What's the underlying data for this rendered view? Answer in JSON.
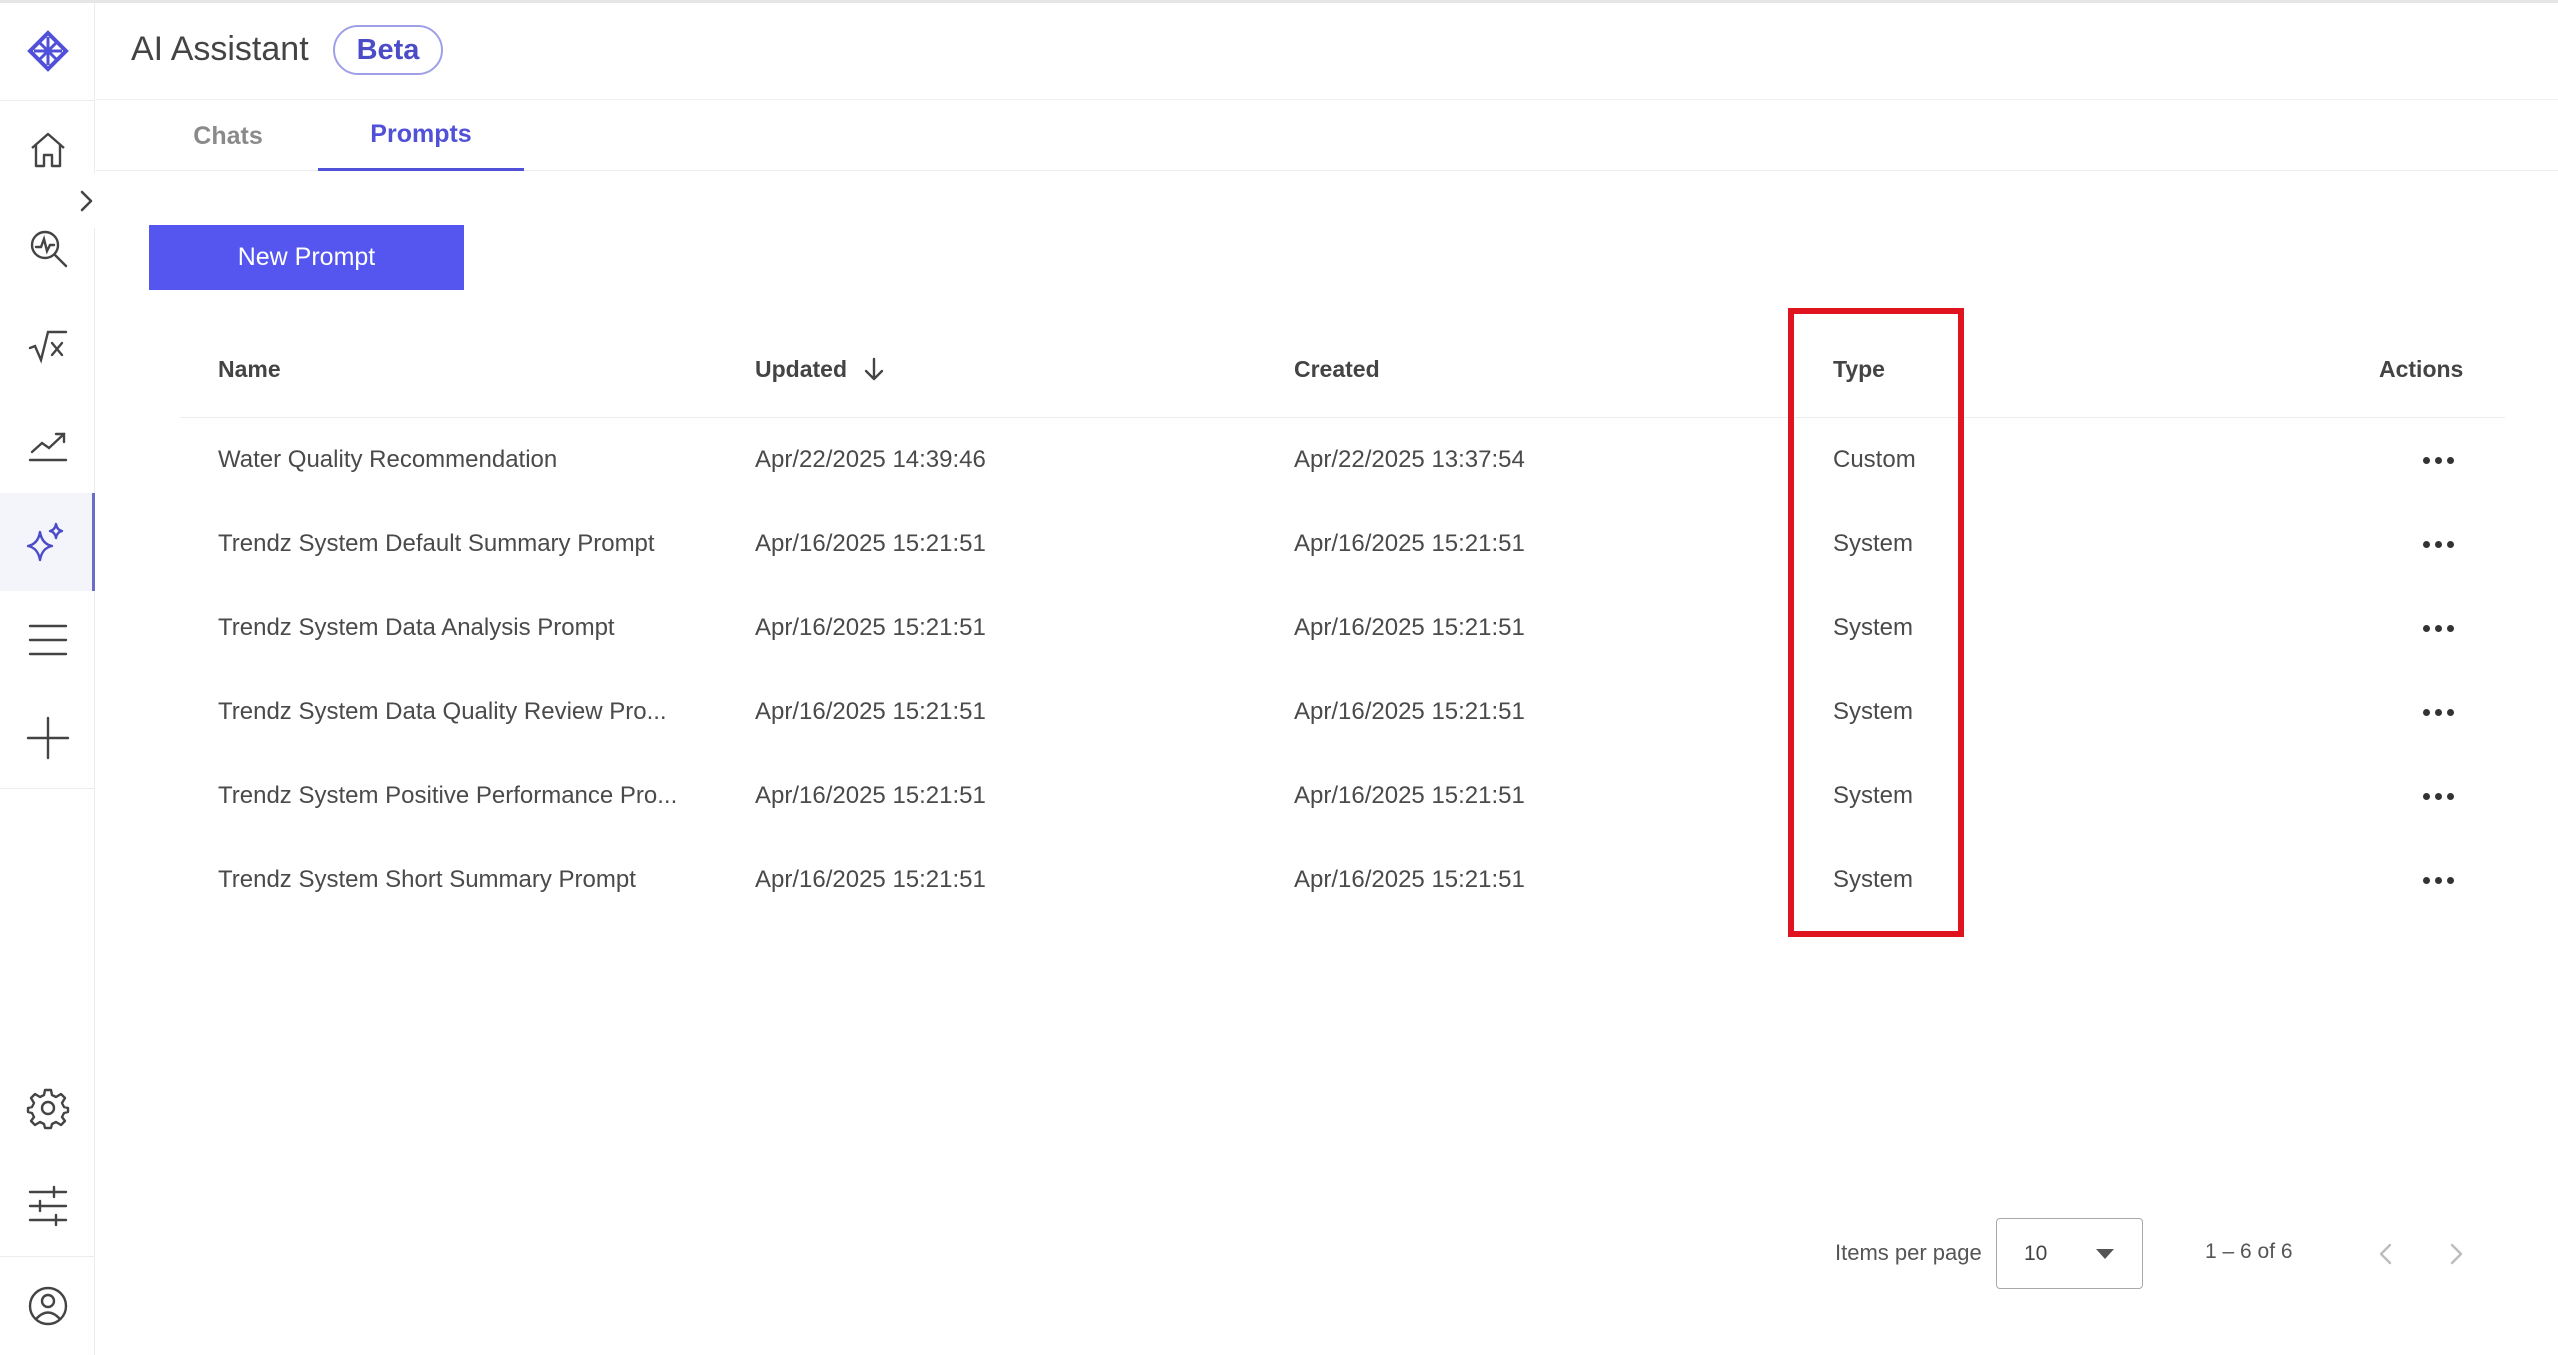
{
  "header": {
    "title": "AI Assistant",
    "badge": "Beta"
  },
  "tabs": [
    {
      "label": "Chats",
      "active": false
    },
    {
      "label": "Prompts",
      "active": true
    }
  ],
  "toolbar": {
    "new_prompt_label": "New Prompt"
  },
  "table": {
    "columns": {
      "name": "Name",
      "updated": "Updated",
      "created": "Created",
      "type": "Type",
      "actions": "Actions"
    },
    "sort": {
      "column": "updated",
      "direction": "desc"
    },
    "rows": [
      {
        "name": "Water Quality Recommendation",
        "updated": "Apr/22/2025 14:39:46",
        "created": "Apr/22/2025 13:37:54",
        "type": "Custom"
      },
      {
        "name": "Trendz System Default Summary Prompt",
        "updated": "Apr/16/2025 15:21:51",
        "created": "Apr/16/2025 15:21:51",
        "type": "System"
      },
      {
        "name": "Trendz System Data Analysis Prompt",
        "updated": "Apr/16/2025 15:21:51",
        "created": "Apr/16/2025 15:21:51",
        "type": "System"
      },
      {
        "name": "Trendz System Data Quality Review Pro...",
        "updated": "Apr/16/2025 15:21:51",
        "created": "Apr/16/2025 15:21:51",
        "type": "System"
      },
      {
        "name": "Trendz System Positive Performance Pro...",
        "updated": "Apr/16/2025 15:21:51",
        "created": "Apr/16/2025 15:21:51",
        "type": "System"
      },
      {
        "name": "Trendz System Short Summary Prompt",
        "updated": "Apr/16/2025 15:21:51",
        "created": "Apr/16/2025 15:21:51",
        "type": "System"
      }
    ]
  },
  "pagination": {
    "items_per_page_label": "Items per page",
    "items_per_page": "10",
    "range": "1 – 6 of 6"
  },
  "sidebar": {
    "icons": [
      "logo-icon",
      "home-icon",
      "search-analytics-icon",
      "sqrt-formula-icon",
      "trend-chart-icon",
      "sparkle-ai-icon",
      "menu-icon",
      "plus-icon",
      "gear-icon",
      "sliders-icon",
      "user-icon"
    ],
    "active": "sparkle-ai-icon"
  },
  "colors": {
    "accent": "#5555f0",
    "highlight": "#e0141e",
    "tab_active": "#5050d8"
  }
}
